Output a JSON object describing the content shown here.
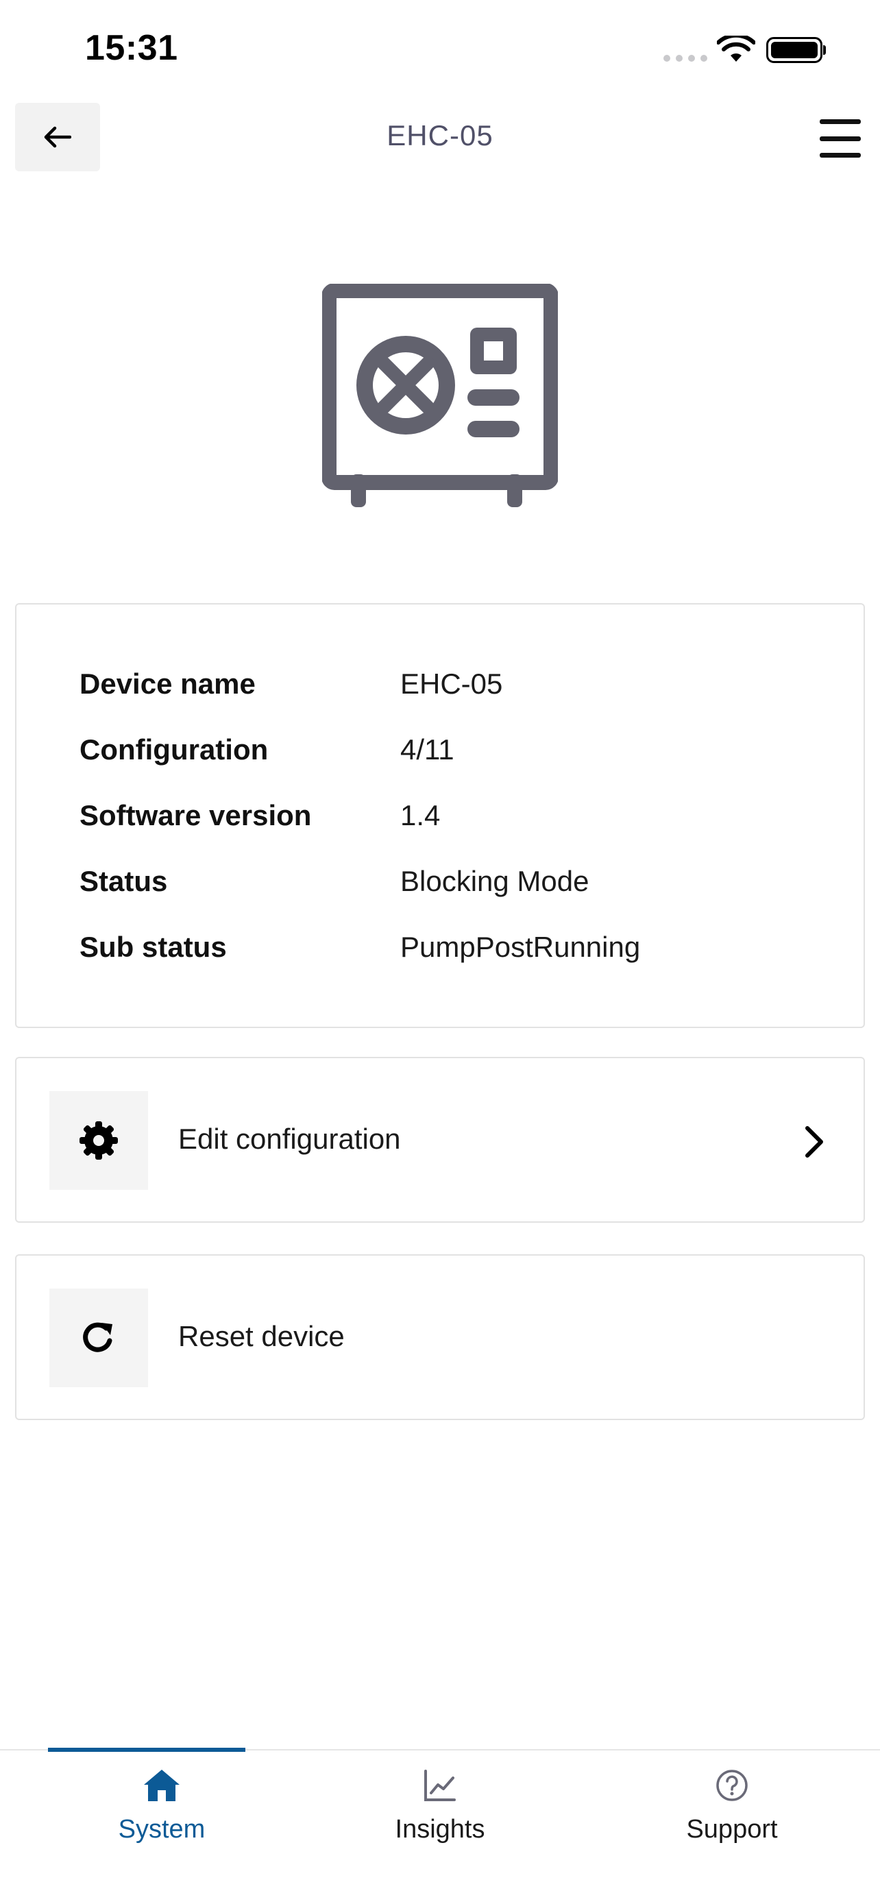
{
  "status_bar": {
    "time": "15:31"
  },
  "header": {
    "title": "EHC-05",
    "back_icon": "arrow-left-icon",
    "menu_icon": "hamburger-menu-icon"
  },
  "device": {
    "illustration_icon": "heat-pump-unit-icon"
  },
  "info": {
    "rows": [
      {
        "label": "Device name",
        "value": "EHC-05"
      },
      {
        "label": "Configuration",
        "value": "4/11"
      },
      {
        "label": "Software version",
        "value": "1.4"
      },
      {
        "label": "Status",
        "value": "Blocking Mode"
      },
      {
        "label": "Sub status",
        "value": "PumpPostRunning"
      }
    ]
  },
  "actions": {
    "edit": {
      "label": "Edit configuration",
      "icon": "gear-icon"
    },
    "reset": {
      "label": "Reset device",
      "icon": "refresh-icon"
    }
  },
  "bottom_nav": {
    "items": [
      {
        "label": "System",
        "icon": "home-icon",
        "active": true
      },
      {
        "label": "Insights",
        "icon": "line-chart-icon",
        "active": false
      },
      {
        "label": "Support",
        "icon": "help-circle-icon",
        "active": false
      }
    ]
  },
  "colors": {
    "accent": "#0c5a96",
    "icon_gray": "#62626e",
    "border": "#e2e2e2"
  }
}
